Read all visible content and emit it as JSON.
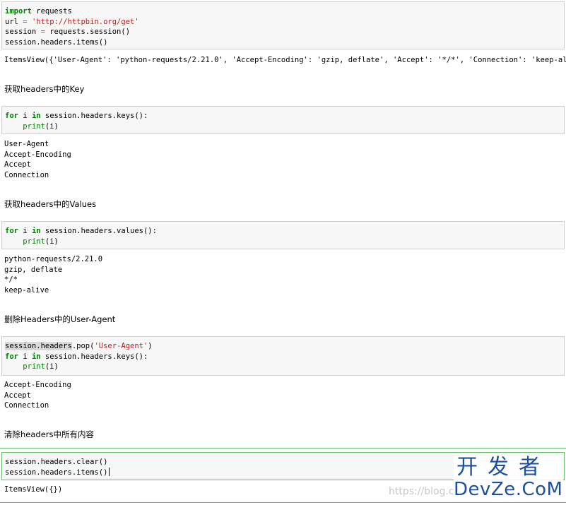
{
  "cells": {
    "c1": {
      "lines": [
        [
          "import",
          " requests"
        ],
        [
          "url",
          " = ",
          "'http://httpbin.org/get'"
        ],
        [
          "session",
          " = ",
          "requests.session()"
        ],
        [
          "session.headers.items()"
        ]
      ],
      "output": "ItemsView({'User-Agent': 'python-requests/2.21.0', 'Accept-Encoding': 'gzip, deflate', 'Accept': '*/*', 'Connection': 'keep-alive'})"
    },
    "md1": "获取headers中的Key",
    "c2": {
      "l1_kw": "for",
      "l1_var": " i ",
      "l1_in": "in",
      "l1_rest": " session.headers.keys():",
      "l2_indent": "    ",
      "l2_fn": "print",
      "l2_args": "(i)",
      "output": "User-Agent\nAccept-Encoding\nAccept\nConnection"
    },
    "md2": "获取headers中的Values",
    "c3": {
      "l1_kw": "for",
      "l1_var": " i ",
      "l1_in": "in",
      "l1_rest": " session.headers.values():",
      "l2_indent": "    ",
      "l2_fn": "print",
      "l2_args": "(i)",
      "output": "python-requests/2.21.0\ngzip, deflate\n*/*\nkeep-alive"
    },
    "md3": "删除Headers中的User-Agent",
    "c4": {
      "l1_hl": "session.headers",
      "l1_rest": ".pop(",
      "l1_str": "'User-Agent'",
      "l1_end": ")",
      "l2_kw": "for",
      "l2_var": " i ",
      "l2_in": "in",
      "l2_rest": " session.headers.keys():",
      "l3_indent": "    ",
      "l3_fn": "print",
      "l3_args": "(i)",
      "output": "Accept-Encoding\nAccept\nConnection"
    },
    "md4": "清除headers中所有内容",
    "c5": {
      "l1": "session.headers.clear()",
      "l2": "session.headers.items()",
      "output": "ItemsView({})"
    }
  },
  "watermark": {
    "url": "https://blog.cs",
    "logo_cn": "开发者",
    "logo_en": "DevZe.CoM"
  },
  "colors": {
    "keyword": "#008000",
    "string": "#ba2121",
    "operator": "#aa22ff",
    "selected_border": "#66bb6a",
    "watermark_logo": "#1f4f9c"
  }
}
